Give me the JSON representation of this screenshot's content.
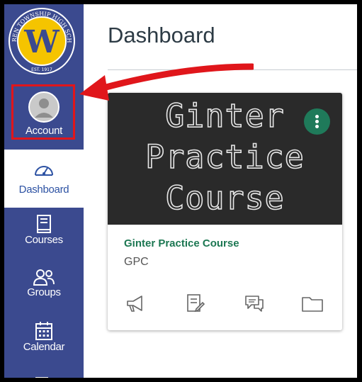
{
  "sidebar": {
    "logo_icon": "school-seal-logo",
    "logo_text_top": "WARREN TOWNSHIP HIGH SCHOOL",
    "logo_letter": "W",
    "logo_text_bottom": "EST. 1917",
    "items": [
      {
        "label": "Account",
        "icon": "avatar-icon",
        "highlighted": true
      },
      {
        "label": "Dashboard",
        "icon": "speedometer-icon",
        "active": true
      },
      {
        "label": "Courses",
        "icon": "book-icon"
      },
      {
        "label": "Groups",
        "icon": "people-icon"
      },
      {
        "label": "Calendar",
        "icon": "calendar-icon"
      }
    ]
  },
  "main": {
    "title": "Dashboard",
    "card": {
      "hero_lines": [
        "Ginter",
        "Practice",
        "Course"
      ],
      "name": "Ginter Practice Course",
      "code": "GPC",
      "actions": [
        "announcements-icon",
        "assignments-icon",
        "discussions-icon",
        "files-icon"
      ],
      "menu_icon": "kebab-menu-icon"
    }
  },
  "colors": {
    "sidebar": "#3b4a8f",
    "highlight_box": "#e0161b",
    "course_green": "#1c7752",
    "kebab_green": "#1f7a5a",
    "logo_gold": "#f5c400"
  }
}
